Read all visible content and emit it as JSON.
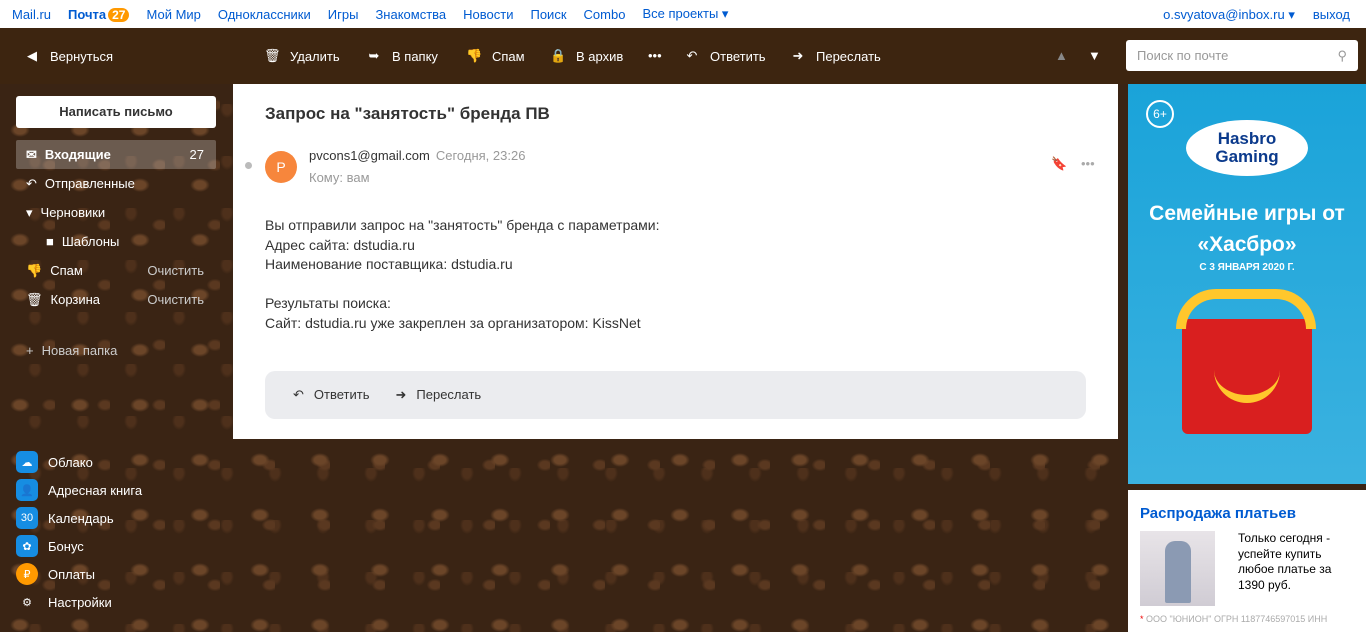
{
  "topnav": {
    "items": [
      "Mail.ru",
      "Почта",
      "Мой Мир",
      "Одноклассники",
      "Игры",
      "Знакомства",
      "Новости",
      "Поиск",
      "Combo",
      "Все проекты ▾"
    ],
    "mail_badge": "27",
    "user": "o.svyatova@inbox.ru ▾",
    "logout": "выход"
  },
  "toolbar": {
    "back": "Вернуться",
    "delete": "Удалить",
    "to_folder": "В папку",
    "spam": "Спам",
    "archive": "В архив",
    "more": "•••",
    "reply": "Ответить",
    "forward": "Переслать",
    "search_placeholder": "Поиск по почте"
  },
  "sidebar": {
    "compose": "Написать письмо",
    "folders": [
      {
        "label": "Входящие",
        "count": "27",
        "icon": "✉"
      },
      {
        "label": "Отправленные",
        "icon": "↶"
      },
      {
        "label": "Черновики",
        "icon": "▾"
      },
      {
        "label": "Шаблоны",
        "icon": "■"
      },
      {
        "label": "Спам",
        "action": "Очистить",
        "icon": "👎"
      },
      {
        "label": "Корзина",
        "action": "Очистить",
        "icon": "🗑"
      }
    ],
    "new_folder": "Новая папка",
    "services": [
      {
        "label": "Облако",
        "icon": "☁"
      },
      {
        "label": "Адресная книга",
        "icon": "👤"
      },
      {
        "label": "Календарь",
        "icon": "30"
      },
      {
        "label": "Бонус",
        "icon": "✿"
      },
      {
        "label": "Оплаты",
        "icon": "₽"
      },
      {
        "label": "Настройки",
        "icon": "⚙"
      }
    ]
  },
  "message": {
    "subject": "Запрос на \"занятость\" бренда ПВ",
    "avatar": "P",
    "from": "pvcons1@gmail.com",
    "date": "Сегодня, 23:26",
    "to": "Кому: вам",
    "lines": [
      "Вы отправили запрос на \"занятость\" бренда с параметрами:",
      "Адрес сайта: dstudia.ru",
      "Наименование поставщика: dstudia.ru",
      "",
      "Результаты поиска:",
      "Сайт: dstudia.ru уже закреплен за организатором: KissNet"
    ],
    "reply": "Ответить",
    "forward": "Переслать"
  },
  "ad": {
    "age": "6+",
    "brand": "Hasbro Gaming",
    "title": "Семейные игры от «Хасбро»",
    "date": "С 3 ЯНВАРЯ 2020 Г."
  },
  "ad2": {
    "title": "Распродажа платьев",
    "text": "Только сегодня - успейте купить любое платье за 1390 руб.",
    "legal": "ООО \"ЮНИОН\" ОГРН 1187746597015 ИНН"
  }
}
